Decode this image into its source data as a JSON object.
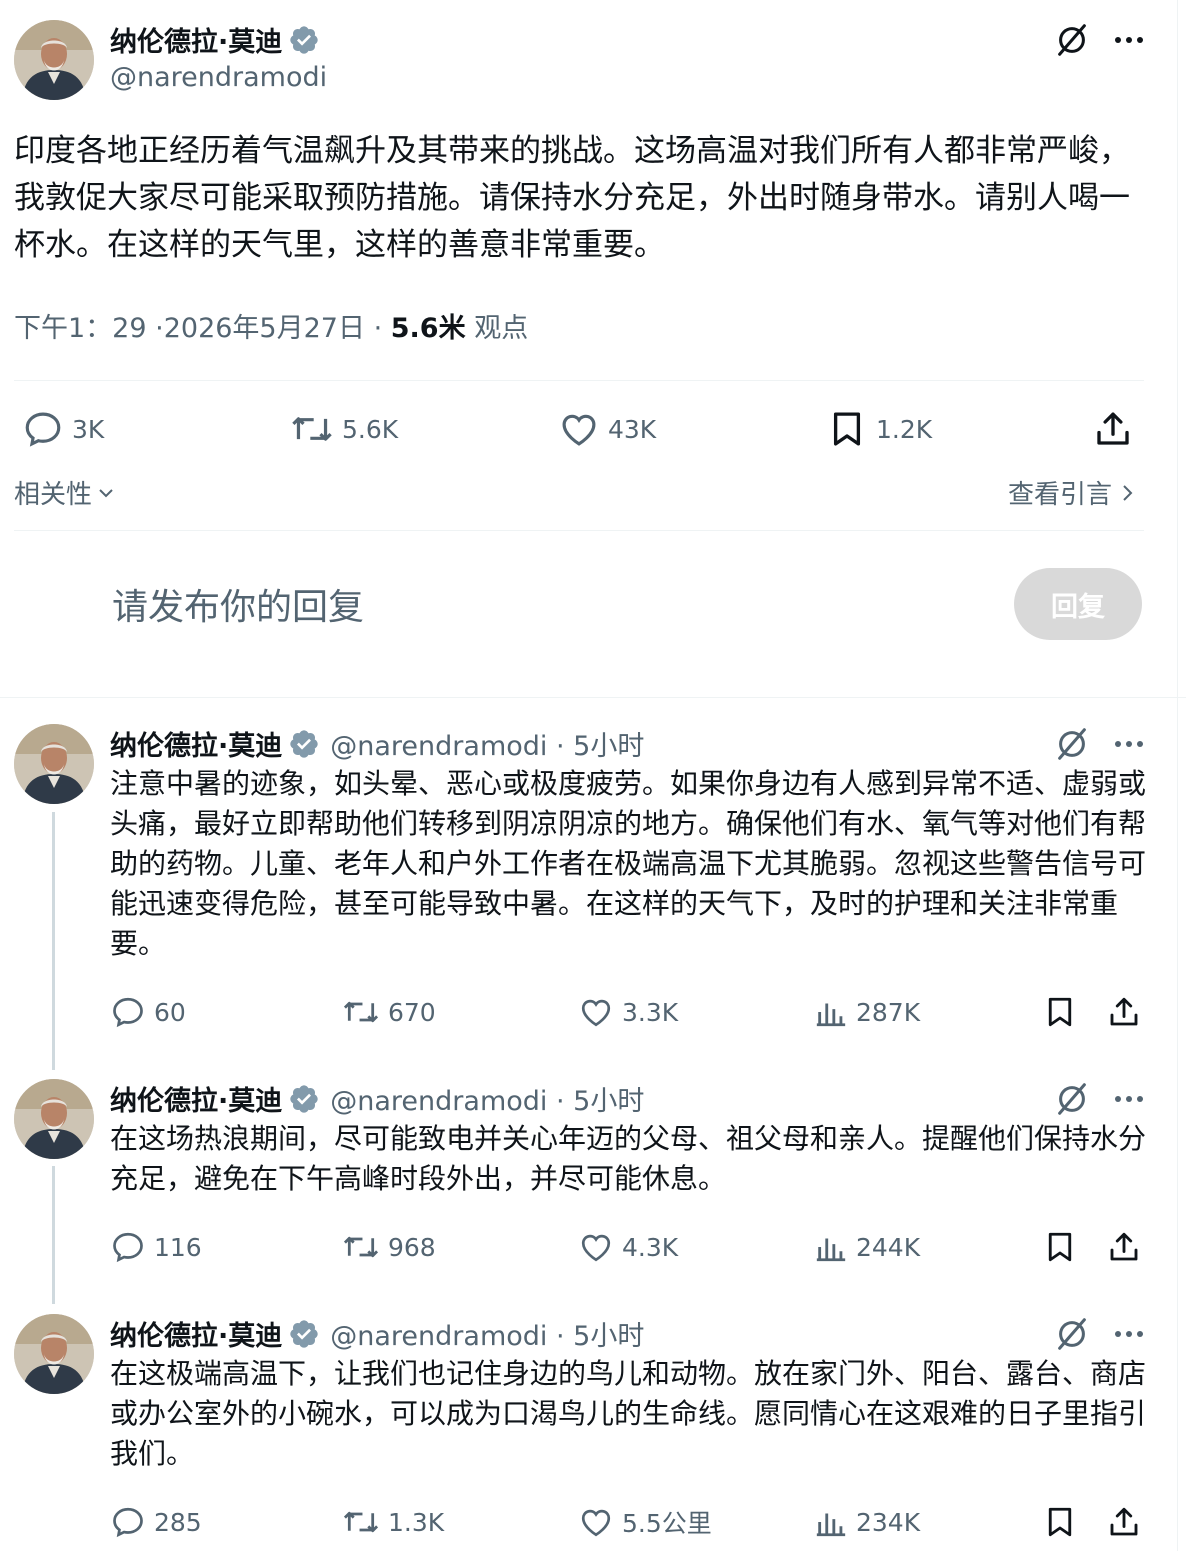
{
  "main_tweet": {
    "author_name": "纳伦德拉·莫迪",
    "handle": "@narendramodi",
    "text": "印度各地正经历着气温飙升及其带来的挑战。这场高温对我们所有人都非常严峻，我敦促大家尽可能采取预防措施。请保持水分充足，外出时随身带水。请别人喝一杯水。在这样的天气里，这样的善意非常重要。",
    "time": "下午1：29",
    "date": "·2026年5月27日",
    "dot": "·",
    "views_count": "5.6米",
    "views_label": "观点",
    "replies": "3K",
    "retweets": "5.6K",
    "likes": "43K",
    "bookmarks": "1.2K"
  },
  "sort": {
    "label": "相关性"
  },
  "quotes_link": {
    "label": "查看引言"
  },
  "composer": {
    "placeholder": "请发布你的回复",
    "button": "回复"
  },
  "replies": [
    {
      "author_name": "纳伦德拉·莫迪",
      "handle_time": "@narendramodi · 5小时",
      "text": "注意中暑的迹象，如头晕、恶心或极度疲劳。如果你身边有人感到异常不适、虚弱或头痛，最好立即帮助他们转移到阴凉阴凉的地方。确保他们有水、氧气等对他们有帮助的药物。儿童、老年人和户外工作者在极端高温下尤其脆弱。忽视这些警告信号可能迅速变得危险，甚至可能导致中暑。在这样的天气下，及时的护理和关注非常重要。",
      "replies": "60",
      "retweets": "670",
      "likes": "3.3K",
      "views": "287K"
    },
    {
      "author_name": "纳伦德拉·莫迪",
      "handle_time": "@narendramodi · 5小时",
      "text": "在这场热浪期间，尽可能致电并关心年迈的父母、祖父母和亲人。提醒他们保持水分充足，避免在下午高峰时段外出，并尽可能休息。",
      "replies": "116",
      "retweets": "968",
      "likes": "4.3K",
      "views": "244K"
    },
    {
      "author_name": "纳伦德拉·莫迪",
      "handle_time": "@narendramodi · 5小时",
      "text": "在这极端高温下，让我们也记住身边的鸟儿和动物。放在家门外、阳台、露台、商店或办公室外的小碗水，可以成为口渴鸟儿的生命线。愿同情心在这艰难的日子里指引我们。",
      "replies": "285",
      "retweets": "1.3K",
      "likes": "5.5公里",
      "views": "234K"
    }
  ],
  "colors": {
    "text": "#0f1419",
    "secondary": "#536471",
    "verified": "#829aab",
    "divider": "#eff3f4",
    "reply_button": "#d9d9d9"
  }
}
